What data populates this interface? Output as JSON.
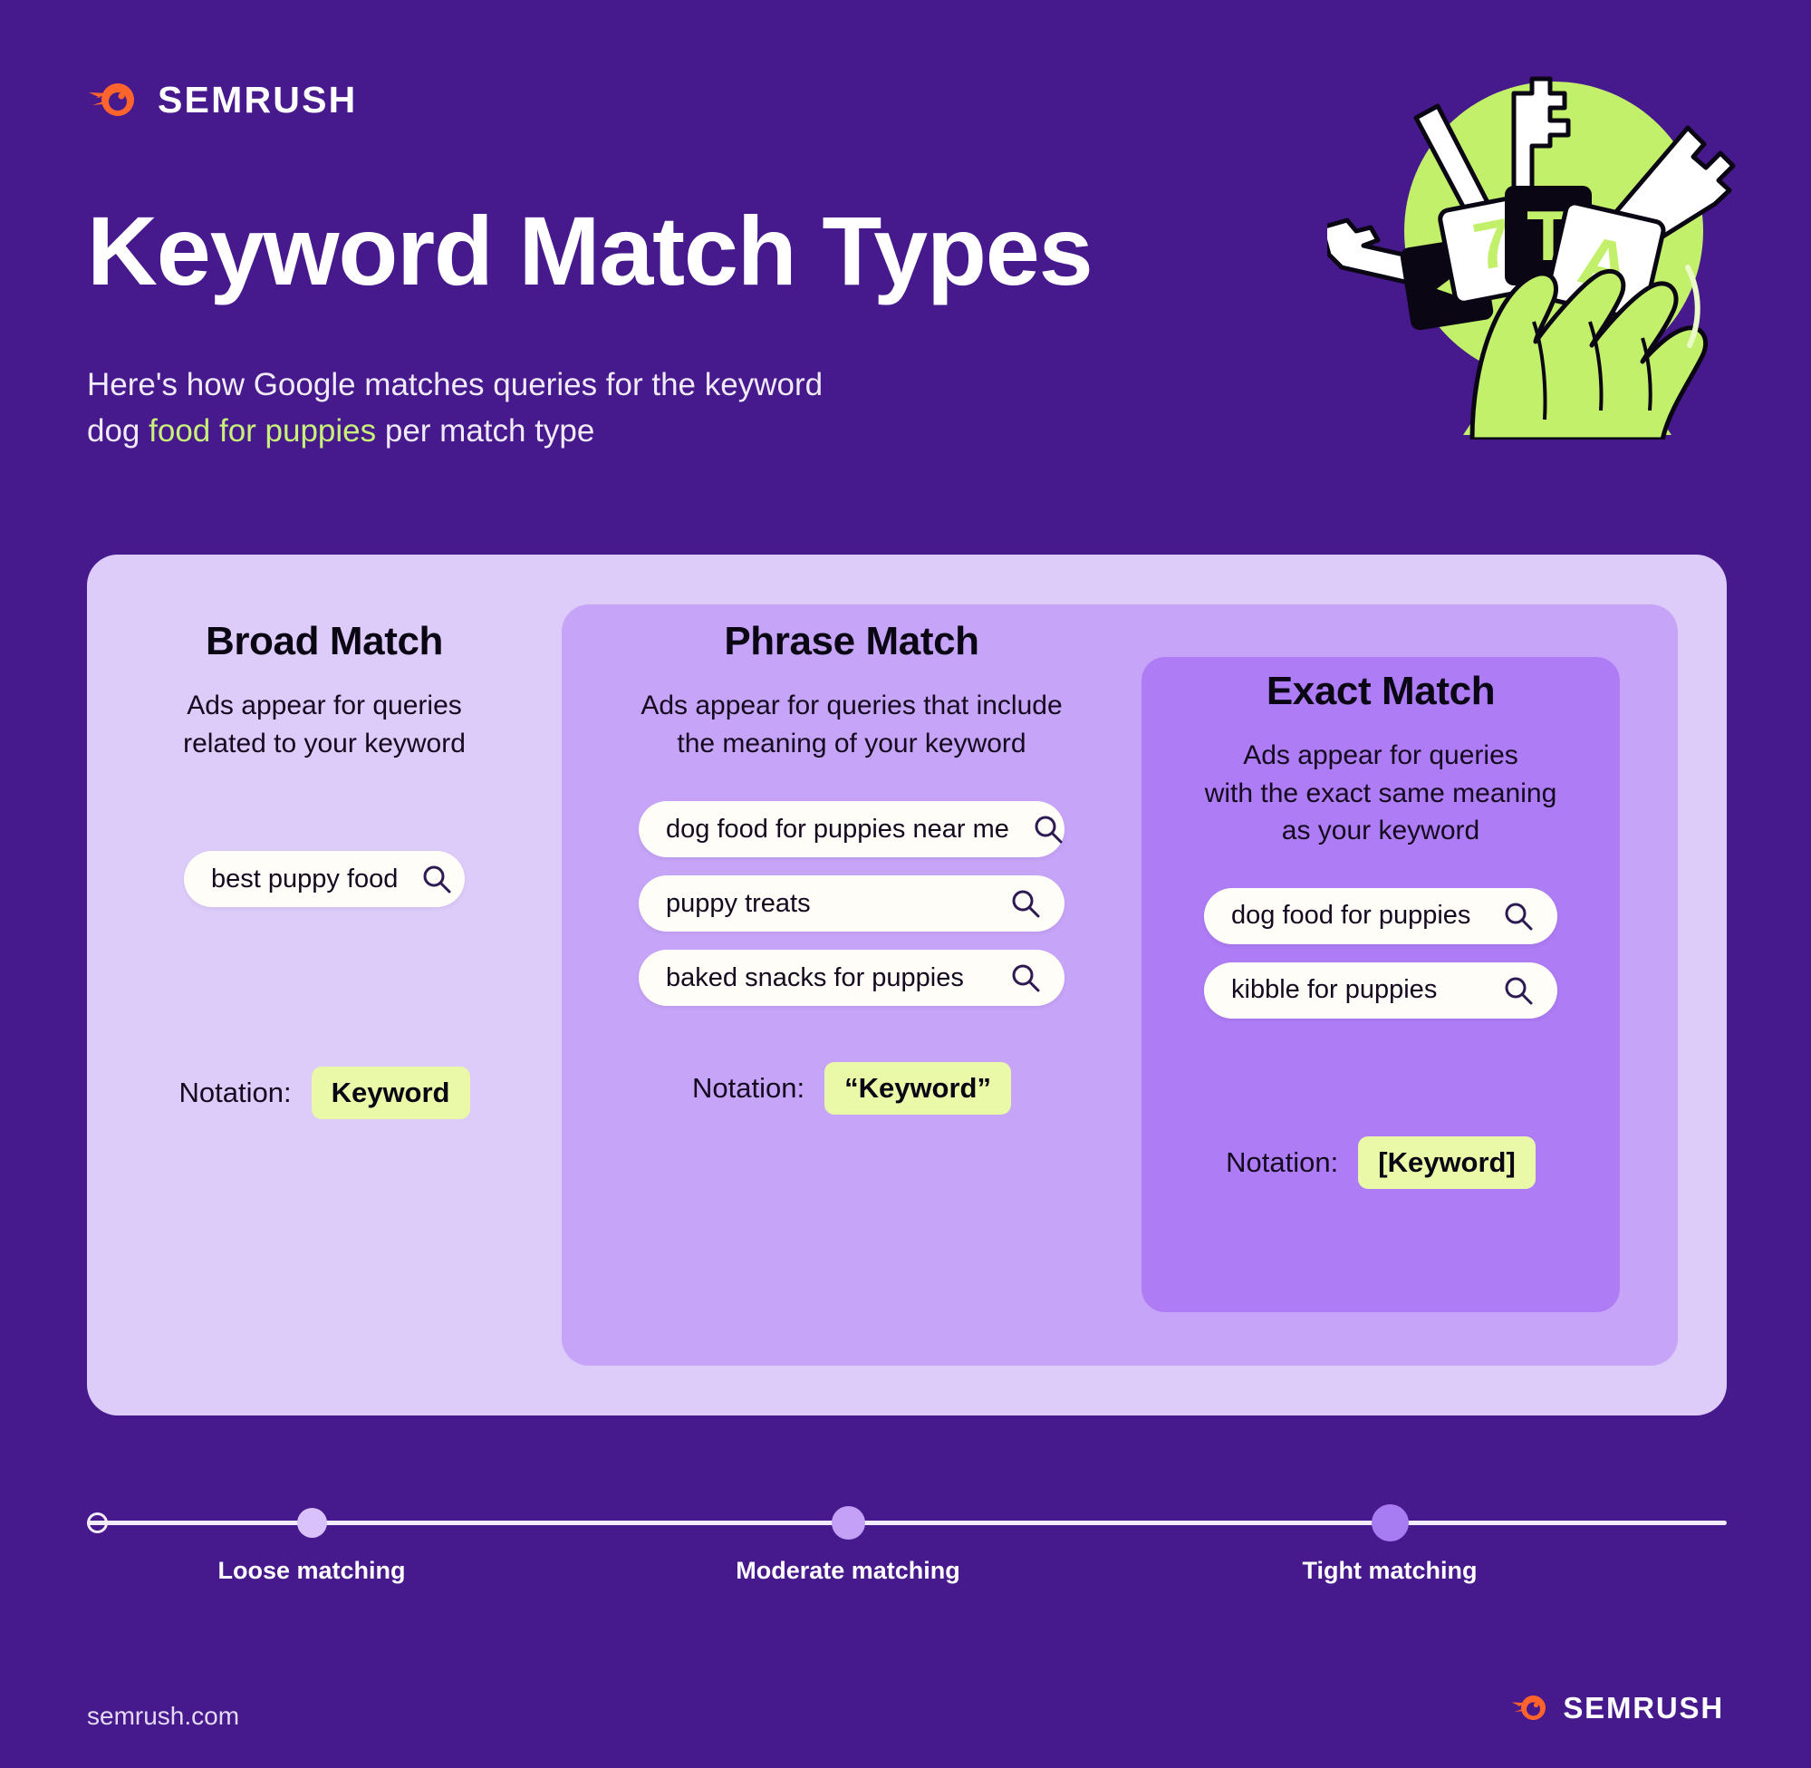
{
  "brand": {
    "name": "SEMRUSH",
    "footer_url": "semrush.com"
  },
  "header": {
    "title": "Keyword Match Types",
    "subtitle_line1": "Here's how Google matches queries for the keyword",
    "subtitle_line2_prefix": "dog ",
    "subtitle_line2_keyword": "food for puppies",
    "subtitle_line2_suffix": " per match type"
  },
  "illustration": {
    "name": "hand-holding-keys-and-keycaps",
    "circle_color": "#c2f06a",
    "keycap_letters": [
      "7",
      "T",
      "A"
    ]
  },
  "columns": [
    {
      "id": "broad",
      "title": "Broad Match",
      "desc_line1": "Ads appear for queries",
      "desc_line2": "related to your keyword",
      "queries": [
        "best puppy food"
      ],
      "notation_label": "Notation:",
      "notation_value": "Keyword"
    },
    {
      "id": "phrase",
      "title": "Phrase Match",
      "desc_line1": "Ads appear for queries that include",
      "desc_line2": "the meaning of your keyword",
      "queries": [
        "dog food for puppies near me",
        "puppy treats",
        "baked snacks for puppies"
      ],
      "notation_label": "Notation:",
      "notation_value": "“Keyword”"
    },
    {
      "id": "exact",
      "title": "Exact Match",
      "desc_line1": "Ads appear for queries",
      "desc_line2": "with the exact same meaning",
      "desc_line3": "as your keyword",
      "queries": [
        "dog food for puppies",
        "kibble for puppies"
      ],
      "notation_label": "Notation:",
      "notation_value": "[Keyword]"
    }
  ],
  "scale": {
    "markers": [
      {
        "label": "Loose matching",
        "color": "#d9c2fb"
      },
      {
        "label": "Moderate matching",
        "color": "#c4a0f7"
      },
      {
        "label": "Tight matching",
        "color": "#a77cf2"
      }
    ]
  },
  "colors": {
    "background": "#46198c",
    "panel_outer": "#ddccf9",
    "panel_mid": "#c6a4f7",
    "panel_inner": "#ae7cf5",
    "accent_green": "#c8f07a",
    "badge_green": "#e9f9a8",
    "logo_orange": "#ff642d",
    "pill_white": "#fffdf8"
  }
}
